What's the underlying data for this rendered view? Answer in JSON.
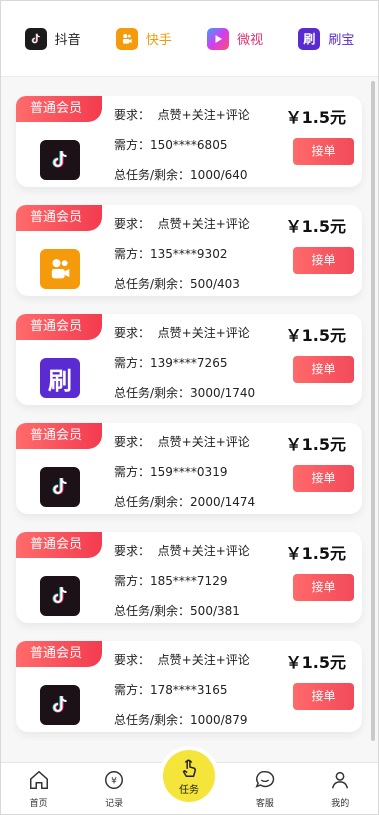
{
  "tabs": [
    {
      "label": "抖音",
      "icon": "douyin-icon",
      "color": "#222222"
    },
    {
      "label": "快手",
      "icon": "kuaishou-icon",
      "color": "#f59a0a"
    },
    {
      "label": "微视",
      "icon": "weishi-icon",
      "color": "#e0356e"
    },
    {
      "label": "刷宝",
      "icon": "shuabao-icon",
      "color": "#5a2bd0"
    }
  ],
  "cards": [
    {
      "badge": "普通会员",
      "platform": "douyin",
      "req_label": "要求：",
      "req": "点赞+关注+评论",
      "phone_label": "需方：",
      "phone": "150****6805",
      "total_label": "总任务/剩余：",
      "total": "1000/640",
      "price": "￥1.5元",
      "button": "接单"
    },
    {
      "badge": "普通会员",
      "platform": "kuaishou",
      "req_label": "要求：",
      "req": "点赞+关注+评论",
      "phone_label": "需方：",
      "phone": "135****9302",
      "total_label": "总任务/剩余：",
      "total": "500/403",
      "price": "￥1.5元",
      "button": "接单"
    },
    {
      "badge": "普通会员",
      "platform": "shuabao",
      "req_label": "要求：",
      "req": "点赞+关注+评论",
      "phone_label": "需方：",
      "phone": "139****7265",
      "total_label": "总任务/剩余：",
      "total": "3000/1740",
      "price": "￥1.5元",
      "button": "接单"
    },
    {
      "badge": "普通会员",
      "platform": "douyin",
      "req_label": "要求：",
      "req": "点赞+关注+评论",
      "phone_label": "需方：",
      "phone": "159****0319",
      "total_label": "总任务/剩余：",
      "total": "2000/1474",
      "price": "￥1.5元",
      "button": "接单"
    },
    {
      "badge": "普通会员",
      "platform": "douyin",
      "req_label": "要求：",
      "req": "点赞+关注+评论",
      "phone_label": "需方：",
      "phone": "185****7129",
      "total_label": "总任务/剩余：",
      "total": "500/381",
      "price": "￥1.5元",
      "button": "接单"
    },
    {
      "badge": "普通会员",
      "platform": "douyin",
      "req_label": "要求：",
      "req": "点赞+关注+评论",
      "phone_label": "需方：",
      "phone": "178****3165",
      "total_label": "总任务/剩余：",
      "total": "1000/879",
      "price": "￥1.5元",
      "button": "接单"
    }
  ],
  "nav": {
    "home": "首页",
    "records": "记录",
    "task": "任务",
    "service": "客服",
    "mine": "我的"
  },
  "colors": {
    "accent_red": "#f33b4f",
    "task_yellow": "#f5e53a"
  }
}
